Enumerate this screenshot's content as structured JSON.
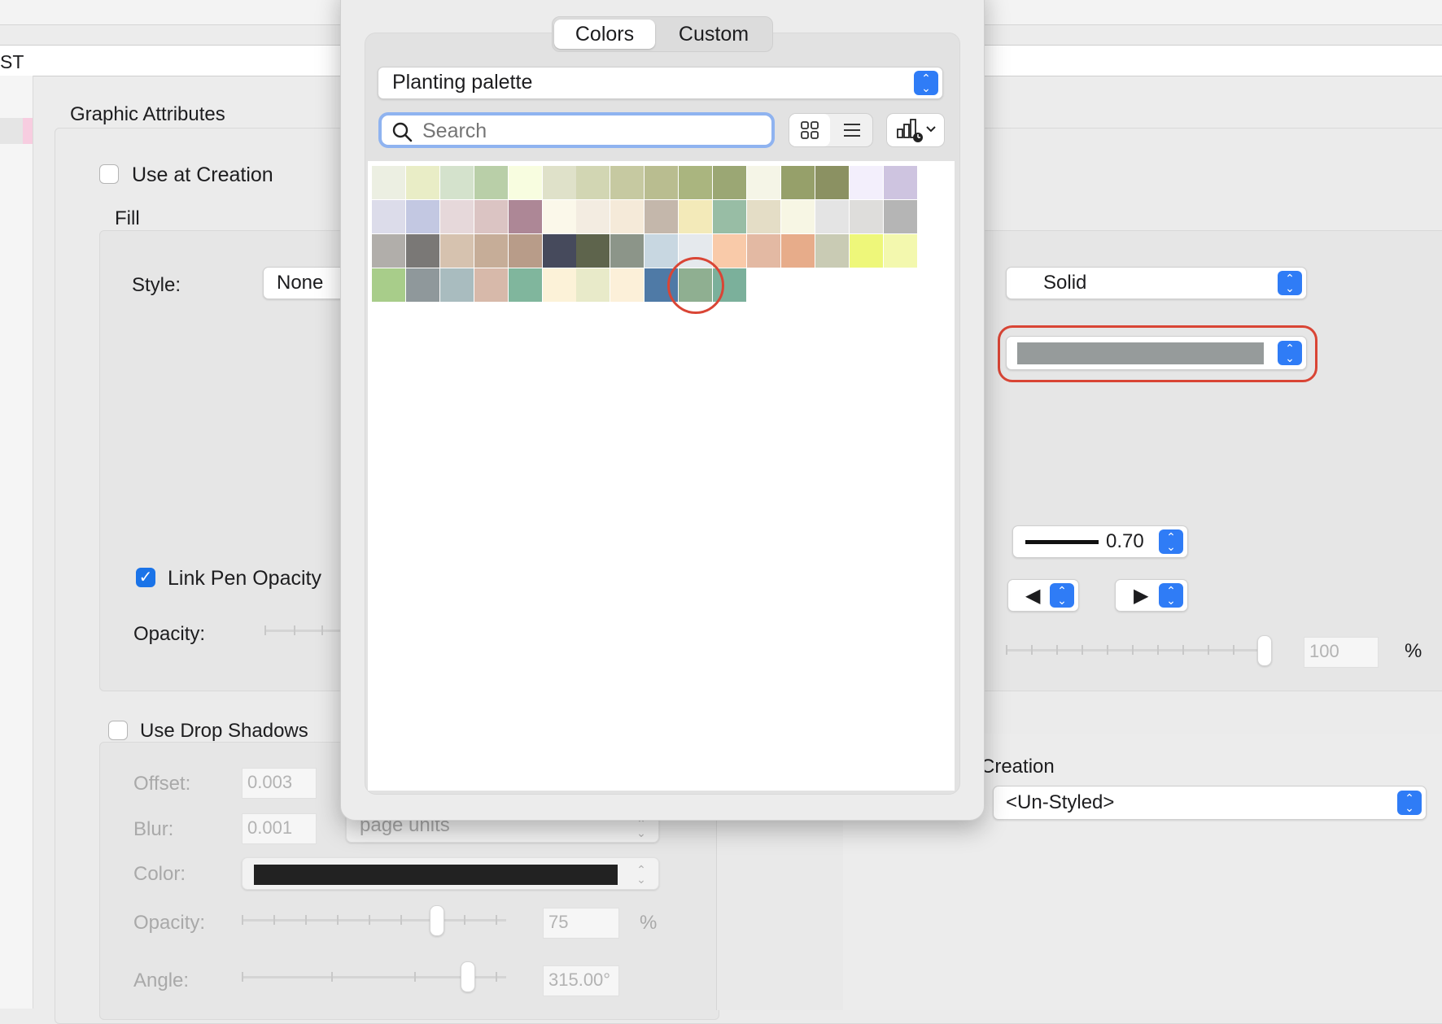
{
  "window": {
    "title_fragment": "ST"
  },
  "graphic": {
    "section_title": "Graphic Attributes",
    "use_at_creation": "Use at Creation",
    "fill_label": "Fill",
    "style_label": "Style:",
    "style_value": "None",
    "pen_style_value": "Solid",
    "pen_color": "#969b9b",
    "line_weight": "0.70",
    "link_pen_opacity": "Link Pen Opacity",
    "opacity_label": "Opacity:",
    "opacity_value": "100",
    "percent": "%",
    "arrow_left": "◀",
    "arrow_right": "▶"
  },
  "shadows": {
    "use_label": "Use Drop Shadows",
    "offset_label": "Offset:",
    "offset_value": "0.003",
    "blur_label": "Blur:",
    "blur_value": "0.001",
    "units_value": "page units",
    "color_label": "Color:",
    "shadow_color": "#222222",
    "opacity_label": "Opacity:",
    "opacity_value": "75",
    "percent": "%",
    "angle_label": "Angle:",
    "angle_value": "315.00°"
  },
  "class_creation": {
    "label": "Creation",
    "value": "<Un-Styled>"
  },
  "picker": {
    "tabs": [
      "Colors",
      "Custom"
    ],
    "active_tab": "Colors",
    "palette": "Planting palette",
    "search_placeholder": "Search",
    "selected_index": 57,
    "swatch_rows": [
      [
        "#ecefe2",
        "#e9edc6",
        "#d4e2cc",
        "#b9cfa8",
        "#f8fde0",
        "#dfe1c9",
        "#d2d6b3",
        "#c6c9a1",
        "#b9bd90",
        "#aab57f",
        "#9ba774",
        "#f5f5e7",
        "#96a06a",
        "#8b9162",
        "#f3effc",
        "#cec4e0"
      ],
      [
        "#dcdcea",
        "#c3c8e2",
        "#e6d8da",
        "#dbc4c3",
        "#ad8796",
        "#fbf8ea",
        "#f3ece1",
        "#f5ead9",
        "#c4b7ab",
        "#f3eab9",
        "#98bda5",
        "#e4ddc6",
        "#f7f6e4",
        "#e4e4e4",
        "#dedddb",
        "#b5b5b5"
      ],
      [
        "#b1aeaa",
        "#7a7876",
        "#d6c2af",
        "#c6ad98",
        "#b89c89",
        "#464a5c",
        "#5e644c",
        "#8c9589",
        "#c8d7e1",
        "#e5e9ed",
        "#f9caa9",
        "#e3b9a3",
        "#e7ac8a",
        "#c9cbb4",
        "#eef77a",
        "#f3f8ae"
      ],
      [
        "#a8cd8a",
        "#8f989b",
        "#a9bcbf",
        "#d7b9aa",
        "#80b69d",
        "#fcf2d8",
        "#e8eac9",
        "#fcf0d9",
        "#4f7aa6",
        "#8faf91",
        "#7bb09b"
      ]
    ]
  }
}
